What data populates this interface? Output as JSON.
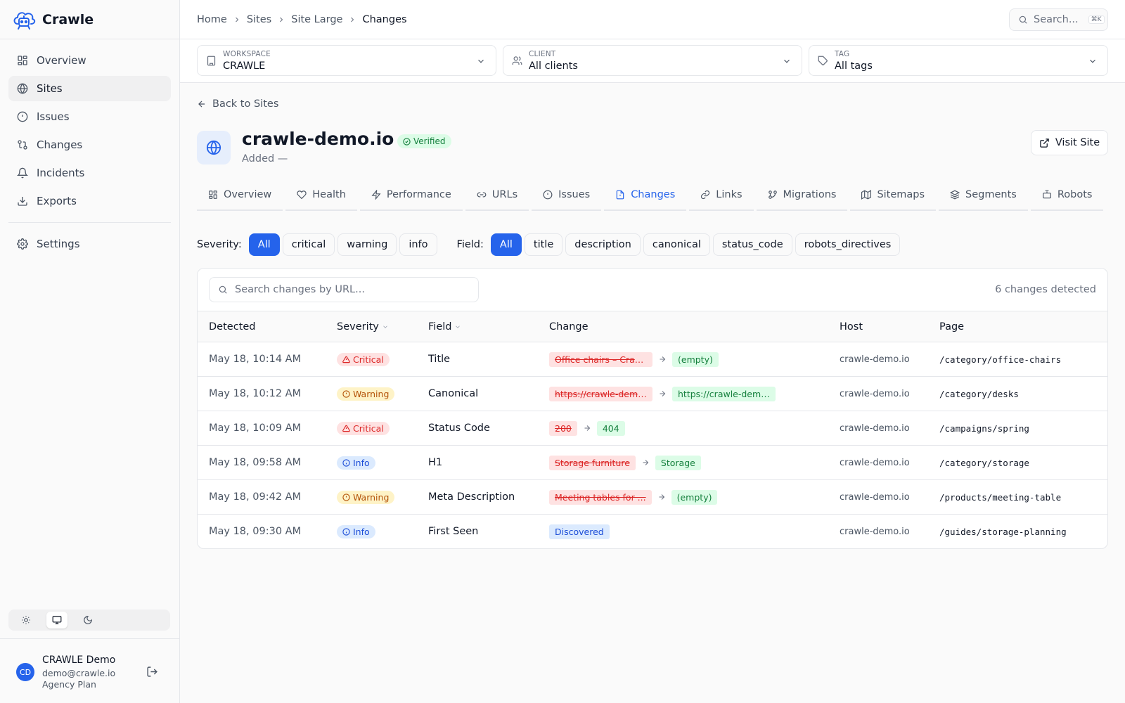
{
  "brand": {
    "name": "Crawle"
  },
  "sidebar": {
    "items": [
      {
        "label": "Overview",
        "icon": "layout-grid-icon"
      },
      {
        "label": "Sites",
        "icon": "globe-icon",
        "active": true
      },
      {
        "label": "Issues",
        "icon": "alert-circle-icon"
      },
      {
        "label": "Changes",
        "icon": "git-compare-icon"
      },
      {
        "label": "Incidents",
        "icon": "bell-icon"
      },
      {
        "label": "Exports",
        "icon": "download-icon"
      }
    ],
    "settings": {
      "label": "Settings",
      "icon": "gear-icon"
    }
  },
  "theme": {
    "options": [
      "light",
      "system",
      "dark"
    ],
    "selected": "system"
  },
  "user": {
    "initials": "CD",
    "name": "CRAWLE Demo",
    "email": "demo@crawle.io",
    "plan": "Agency Plan"
  },
  "breadcrumb": [
    "Home",
    "Sites",
    "Site Large",
    "Changes"
  ],
  "search": {
    "placeholder": "Search...",
    "shortcut": "⌘K"
  },
  "filters": {
    "workspace": {
      "label": "WORKSPACE",
      "value": "CRAWLE"
    },
    "client": {
      "label": "CLIENT",
      "value": "All clients"
    },
    "tag": {
      "label": "TAG",
      "value": "All tags"
    }
  },
  "site": {
    "back_label": "Back to Sites",
    "name": "crawle-demo.io",
    "verified_label": "Verified",
    "added": "Added —",
    "visit_label": "Visit Site"
  },
  "tabs": [
    {
      "label": "Overview",
      "icon": "layout-grid-icon"
    },
    {
      "label": "Health",
      "icon": "heart-icon"
    },
    {
      "label": "Performance",
      "icon": "zap-icon"
    },
    {
      "label": "URLs",
      "icon": "link-icon"
    },
    {
      "label": "Issues",
      "icon": "alert-circle-icon"
    },
    {
      "label": "Changes",
      "icon": "file-icon",
      "active": true
    },
    {
      "label": "Links",
      "icon": "link-icon"
    },
    {
      "label": "Migrations",
      "icon": "git-branch-icon"
    },
    {
      "label": "Sitemaps",
      "icon": "map-icon"
    },
    {
      "label": "Segments",
      "icon": "layers-icon"
    },
    {
      "label": "Robots",
      "icon": "robot-icon"
    }
  ],
  "severity_filter": {
    "label": "Severity:",
    "options": [
      "All",
      "critical",
      "warning",
      "info"
    ],
    "selected": "All"
  },
  "field_filter": {
    "label": "Field:",
    "options": [
      "All",
      "title",
      "description",
      "canonical",
      "status_code",
      "robots_directives"
    ],
    "selected": "All"
  },
  "changes": {
    "search_placeholder": "Search changes by URL...",
    "count_label": "6 changes detected",
    "columns": [
      "Detected",
      "Severity",
      "Field",
      "Change",
      "Host",
      "Page"
    ],
    "rows": [
      {
        "detected": "May 18, 10:14 AM",
        "severity": "Critical",
        "level": "critical",
        "field": "Title",
        "old": "Office chairs – Crawl...",
        "new": "(empty)",
        "host": "crawle-demo.io",
        "page": "/category/office-chairs"
      },
      {
        "detected": "May 18, 10:12 AM",
        "severity": "Warning",
        "level": "warning",
        "field": "Canonical",
        "old": "https://crawle-demo...",
        "new": "https://crawle-demo...",
        "host": "crawle-demo.io",
        "page": "/category/desks"
      },
      {
        "detected": "May 18, 10:09 AM",
        "severity": "Critical",
        "level": "critical",
        "field": "Status Code",
        "old": "200",
        "new": "404",
        "host": "crawle-demo.io",
        "page": "/campaigns/spring"
      },
      {
        "detected": "May 18, 09:58 AM",
        "severity": "Info",
        "level": "info",
        "field": "H1",
        "old": "Storage furniture",
        "new": "Storage",
        "host": "crawle-demo.io",
        "page": "/category/storage"
      },
      {
        "detected": "May 18, 09:42 AM",
        "severity": "Warning",
        "level": "warning",
        "field": "Meta Description",
        "old": "Meeting tables for ...",
        "new": "(empty)",
        "host": "crawle-demo.io",
        "page": "/products/meeting-table"
      },
      {
        "detected": "May 18, 09:30 AM",
        "severity": "Info",
        "level": "info",
        "field": "First Seen",
        "discovered": "Discovered",
        "host": "crawle-demo.io",
        "page": "/guides/storage-planning"
      }
    ]
  },
  "colors": {
    "accent": "#2563eb",
    "critical": "#dc2626",
    "warning": "#b45309",
    "info": "#1d4ed8",
    "added": "#15803d"
  }
}
